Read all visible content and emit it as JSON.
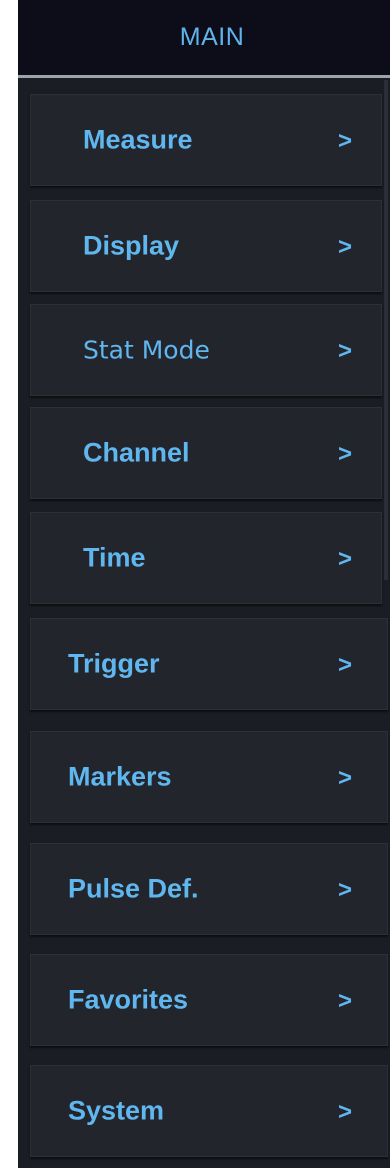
{
  "header": {
    "title": "MAIN"
  },
  "menu": {
    "chevron": ">",
    "items": [
      {
        "label": "Measure"
      },
      {
        "label": "Display"
      },
      {
        "label": "Stat Mode"
      },
      {
        "label": "Channel"
      },
      {
        "label": "Time"
      },
      {
        "label": "Trigger"
      },
      {
        "label": "Markers"
      },
      {
        "label": "Pulse Def."
      },
      {
        "label": "Favorites"
      },
      {
        "label": "System"
      }
    ]
  },
  "colors": {
    "accent": "#60b6ee",
    "panel_bg": "#1b1d24",
    "button_bg": "#23252c",
    "header_bg": "#0c0d18",
    "header_rule": "#9ea2aa"
  }
}
